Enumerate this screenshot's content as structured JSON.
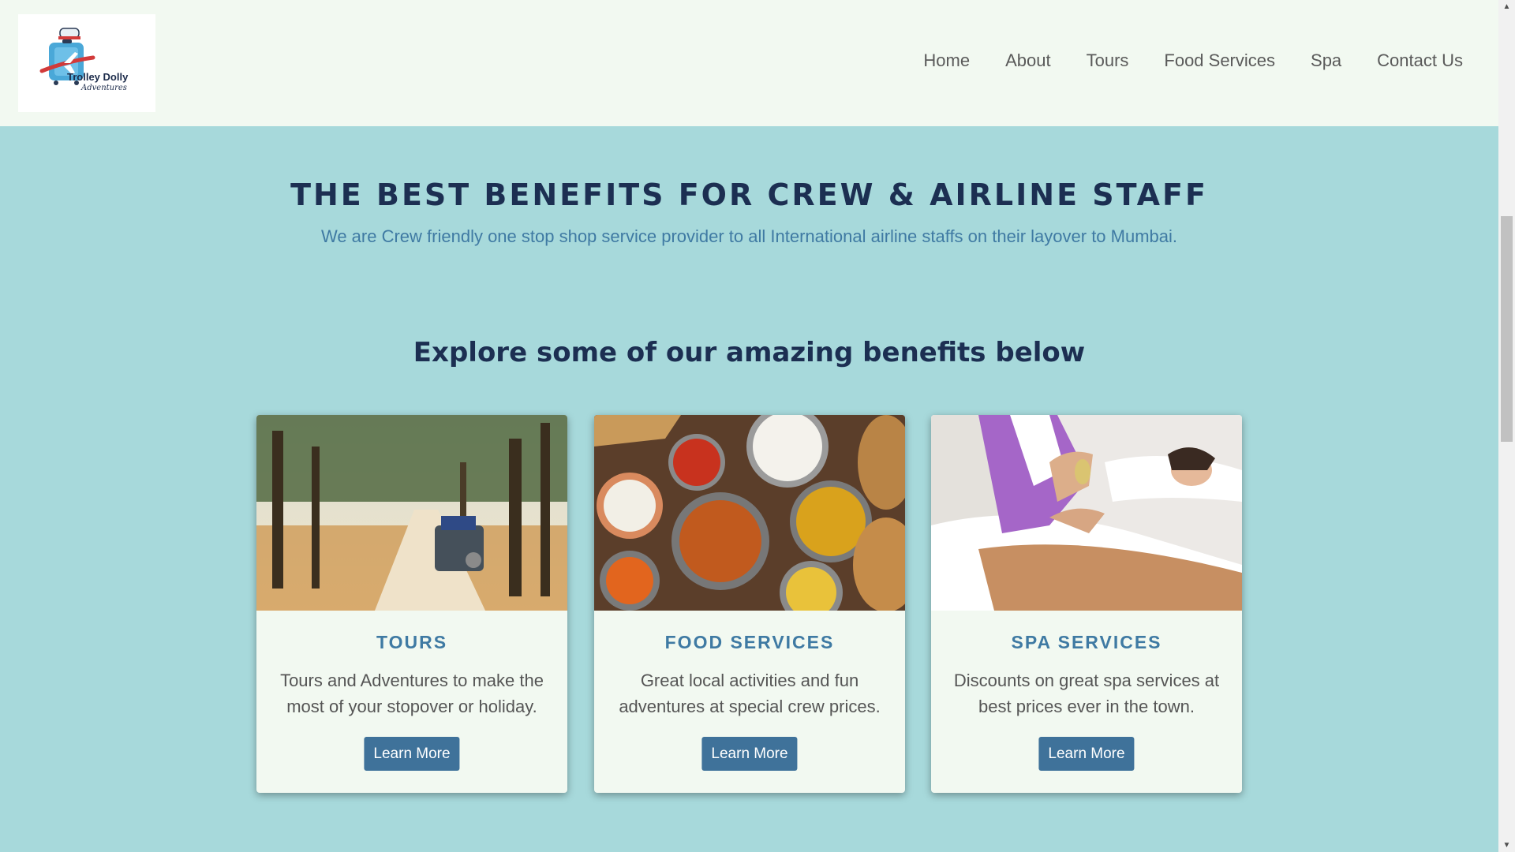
{
  "header": {
    "logo_text": "Trolley Dolly",
    "logo_subtext": "Adventures",
    "nav": [
      {
        "label": "Home"
      },
      {
        "label": "About"
      },
      {
        "label": "Tours"
      },
      {
        "label": "Food Services"
      },
      {
        "label": "Spa"
      },
      {
        "label": "Contact Us"
      }
    ]
  },
  "hero": {
    "headline": "THE BEST BENEFITS FOR CREW & AIRLINE STAFF",
    "subline": "We are Crew friendly one stop shop service provider to all International airline staffs on their layover to Mumbai."
  },
  "benefits": {
    "title": "Explore some of our amazing benefits below",
    "cards": [
      {
        "title": "TOURS",
        "desc": "Tours and Adventures to make the most of your stopover or holiday.",
        "button": "Learn More",
        "image": "jeep-safari-forest"
      },
      {
        "title": "FOOD SERVICES",
        "desc": "Great local activities and fun adventures at special crew prices.",
        "button": "Learn More",
        "image": "indian-food-spread"
      },
      {
        "title": "SPA SERVICES",
        "desc": "Discounts on great spa services at best prices ever in the town.",
        "button": "Learn More",
        "image": "spa-massage"
      }
    ]
  },
  "colors": {
    "page_bg": "#a7d9db",
    "header_bg": "#f2f9f1",
    "heading": "#1c2f52",
    "accent": "#3f7aa3",
    "button": "#3f729a"
  }
}
